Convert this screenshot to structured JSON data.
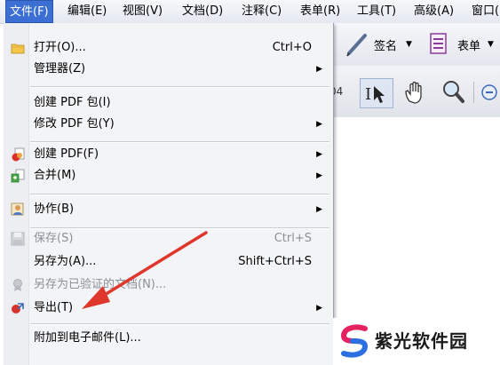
{
  "menubar": {
    "items": [
      {
        "label": "文件(F)"
      },
      {
        "label": "编辑(E)"
      },
      {
        "label": "视图(V)"
      },
      {
        "label": "文档(D)"
      },
      {
        "label": "注释(C)"
      },
      {
        "label": "表单(R)"
      },
      {
        "label": "工具(T)"
      },
      {
        "label": "高级(A)"
      },
      {
        "label": "窗口("
      }
    ]
  },
  "toolbar": {
    "sign_label": "签名",
    "forms_label": "表单",
    "page_fragment": "04"
  },
  "file_menu": {
    "items": [
      {
        "label": "打开(O)...",
        "shortcut": "Ctrl+O",
        "icon": "folder-icon"
      },
      {
        "label": "管理器(Z)",
        "submenu": "▶"
      },
      {
        "label": "创建 PDF 包(I)"
      },
      {
        "label": "修改 PDF 包(Y)",
        "submenu": "▶"
      },
      {
        "label": "创建 PDF(F)",
        "submenu": "▶",
        "icon": "create-pdf-icon"
      },
      {
        "label": "合并(M)",
        "submenu": "▶",
        "icon": "combine-icon"
      },
      {
        "label": "协作(B)",
        "submenu": "▶",
        "icon": "collaborate-icon"
      },
      {
        "label": "保存(S)",
        "shortcut": "Ctrl+S",
        "icon": "save-icon",
        "disabled": true
      },
      {
        "label": "另存为(A)...",
        "shortcut": "Shift+Ctrl+S"
      },
      {
        "label": "另存为已验证的文档(N)...",
        "icon": "certified-doc-icon",
        "disabled": true
      },
      {
        "label": "导出(T)",
        "submenu": "▶",
        "icon": "export-icon"
      },
      {
        "label": "附加到电子邮件(L)..."
      }
    ]
  },
  "watermark": {
    "text": "紫光软件园",
    "colors": {
      "top": "#e5215f",
      "bottom": "#2b6fe0"
    }
  },
  "colors": {
    "menu_active": "#3b6fd4",
    "arrow": "#e0372c"
  }
}
